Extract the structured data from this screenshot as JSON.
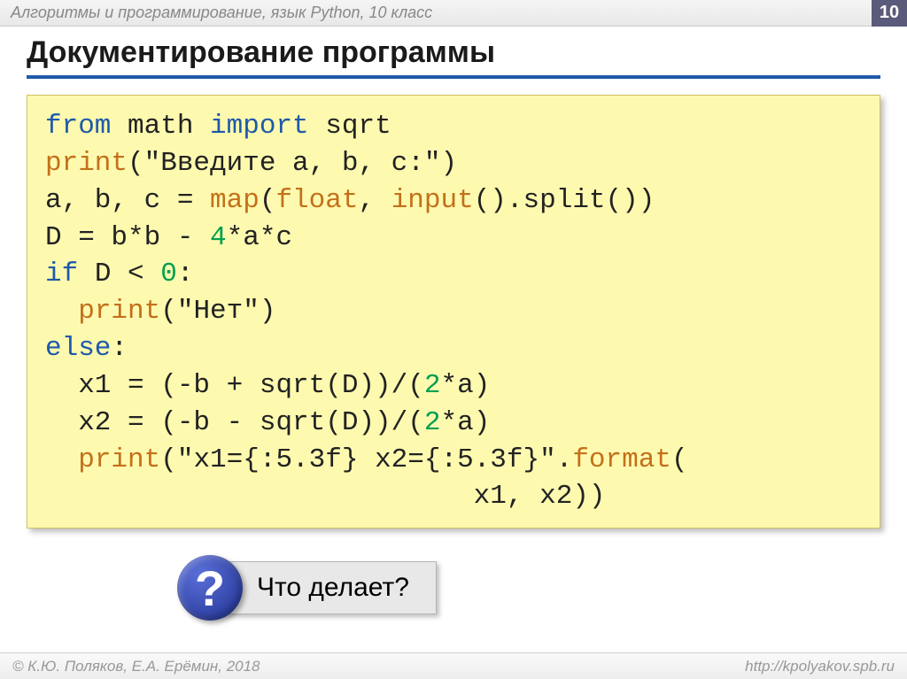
{
  "header": {
    "subject": "Алгоритмы и программирование, язык Python, 10 класс",
    "page": "10"
  },
  "title": "Документирование программы",
  "code": {
    "l1a": "from",
    "l1b": " math ",
    "l1c": "import",
    "l1d": " sqrt",
    "l2a": "print",
    "l2b": "(\"Введите a, b, c:\")",
    "l3a": "a, b, c = ",
    "l3b": "map",
    "l3c": "(",
    "l3d": "float",
    "l3e": ", ",
    "l3f": "input",
    "l3g": "().split())",
    "l4a": "D = b*b - ",
    "l4b": "4",
    "l4c": "*a*c",
    "l5a": "if",
    "l5b": " D < ",
    "l5c": "0",
    "l5d": ":",
    "l6a": "  ",
    "l6b": "print",
    "l6c": "(\"Нет\")",
    "l7a": "else",
    "l7b": ":",
    "l8a": "  x1 = (-b + sqrt(D))/(",
    "l8b": "2",
    "l8c": "*a)",
    "l9a": "  x2 = (-b - sqrt(D))/(",
    "l9b": "2",
    "l9c": "*a)",
    "l10a": "  ",
    "l10b": "print",
    "l10c": "(\"x1={:5.3f} x2={:5.3f}\".",
    "l10d": "format",
    "l10e": "(",
    "l11a": "                          x1, x2))"
  },
  "callout": {
    "badge": "?",
    "text": "Что делает?"
  },
  "footer": {
    "copyright": "© К.Ю. Поляков, Е.А. Ерёмин, 2018",
    "url": "http://kpolyakov.spb.ru"
  }
}
